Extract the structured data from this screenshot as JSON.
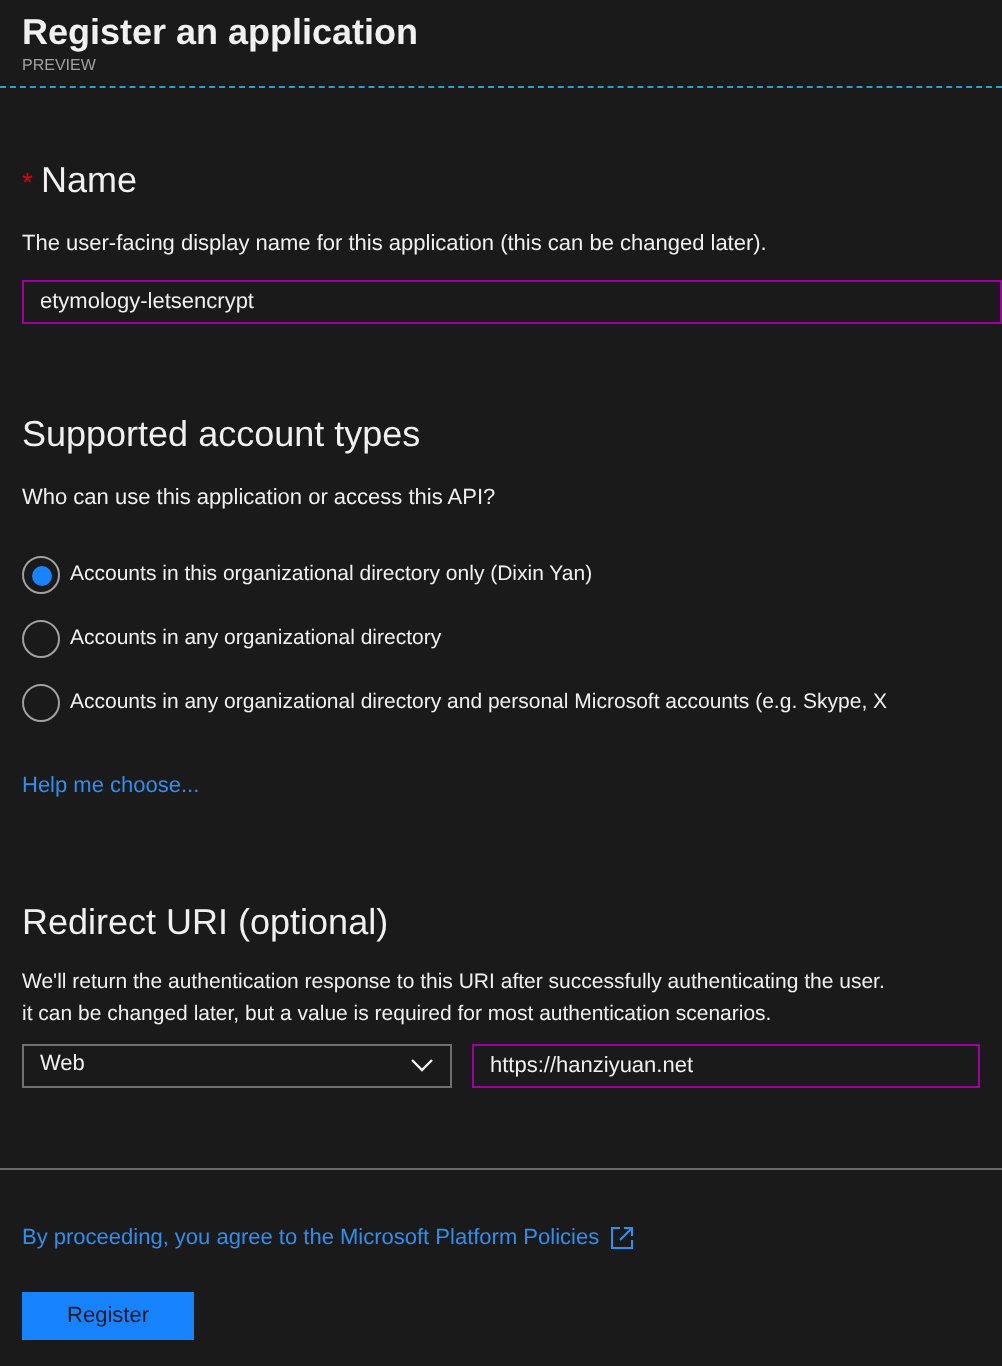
{
  "header": {
    "title": "Register an application",
    "subtitle": "PREVIEW"
  },
  "name_section": {
    "required_mark": "*",
    "heading": "Name",
    "description": "The user-facing display name for this application (this can be changed later).",
    "input": {
      "value": "etymology-letsencrypt"
    }
  },
  "account_types": {
    "heading": "Supported account types",
    "question": "Who can use this application or access this API?",
    "options": [
      {
        "label": "Accounts in this organizational directory only (Dixin Yan)",
        "selected": true
      },
      {
        "label": "Accounts in any organizational directory",
        "selected": false
      },
      {
        "label": "Accounts in any organizational directory and personal Microsoft accounts (e.g. Skype, X",
        "selected": false
      }
    ],
    "help_link": "Help me choose..."
  },
  "redirect_uri": {
    "heading": "Redirect URI (optional)",
    "description_lines": [
      "We'll return the authentication response to this URI after successfully authenticating the user.",
      "it can be changed later, but a value is required for most authentication scenarios."
    ],
    "platform_select": {
      "value": "Web"
    },
    "uri_input": {
      "value": "https://hanziyuan.net"
    }
  },
  "footer": {
    "policy_link": "By proceeding, you agree to the Microsoft Platform Policies",
    "register_button": "Register"
  }
}
